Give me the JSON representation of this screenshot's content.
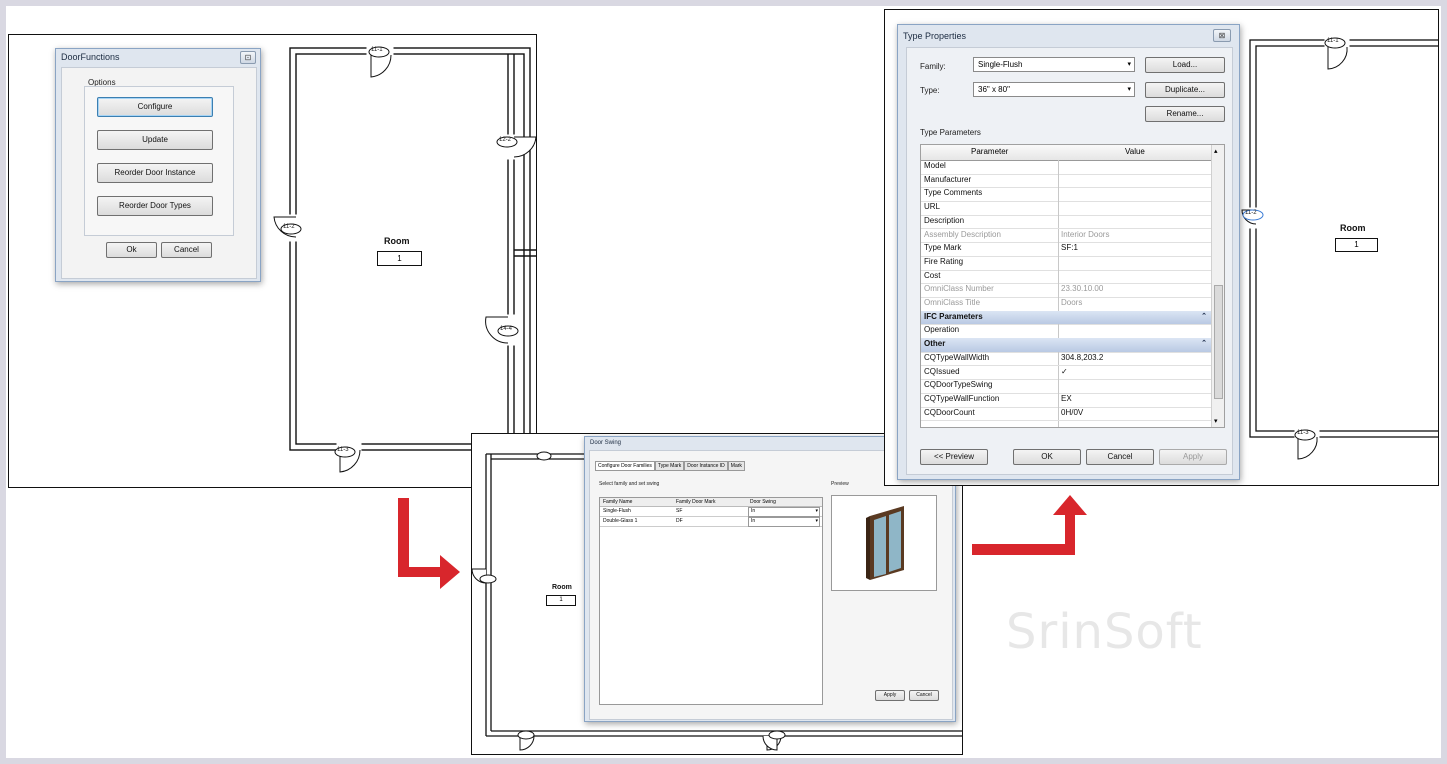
{
  "panel1": {
    "dialog_title": "DoorFunctions",
    "options_label": "Options",
    "buttons": [
      "Configure",
      "Update",
      "Reorder Door Instance",
      "Reorder Door Types"
    ],
    "ok_label": "Ok",
    "cancel_label": "Cancel",
    "room_label": "Room",
    "room_number": "1",
    "door_tags": [
      "11-1",
      "12-2",
      "11-2",
      "14-4",
      "11-3"
    ]
  },
  "panel2": {
    "dialog_title": "Door Swing",
    "tabs": [
      "Configure Door Families",
      "Type Mark",
      "Door Instance ID",
      "Mark"
    ],
    "instruction": "Select family and set swing",
    "preview_label": "Preview",
    "columns": [
      "Family Name",
      "Family Door Mark",
      "Door Swing"
    ],
    "rows": [
      {
        "family": "Single-Flush",
        "mark": "SF",
        "swing": "In"
      },
      {
        "family": "Double-Glass 1",
        "mark": "DF",
        "swing": "In"
      }
    ],
    "apply_label": "Apply",
    "cancel_label": "Cancel",
    "room_label": "Room",
    "room_number": "1"
  },
  "panel3": {
    "dialog_title": "Type Properties",
    "family_label": "Family:",
    "family_value": "Single-Flush",
    "type_label": "Type:",
    "type_value": "36\" x 80\"",
    "load_label": "Load...",
    "duplicate_label": "Duplicate...",
    "rename_label": "Rename...",
    "type_params_label": "Type Parameters",
    "col_parameter": "Parameter",
    "col_value": "Value",
    "params": [
      {
        "name": "Model",
        "value": ""
      },
      {
        "name": "Manufacturer",
        "value": ""
      },
      {
        "name": "Type Comments",
        "value": ""
      },
      {
        "name": "URL",
        "value": ""
      },
      {
        "name": "Description",
        "value": ""
      },
      {
        "name": "Assembly Description",
        "value": "Interior Doors",
        "grey": true
      },
      {
        "name": "Type Mark",
        "value": "SF:1"
      },
      {
        "name": "Fire Rating",
        "value": ""
      },
      {
        "name": "Cost",
        "value": ""
      },
      {
        "name": "OmniClass Number",
        "value": "23.30.10.00",
        "grey": true
      },
      {
        "name": "OmniClass Title",
        "value": "Doors",
        "grey": true
      },
      {
        "group": "IFC Parameters"
      },
      {
        "name": "Operation",
        "value": ""
      },
      {
        "group": "Other"
      },
      {
        "name": "CQTypeWallWidth",
        "value": "304.8,203.2"
      },
      {
        "name": "CQIssued",
        "value": "✓"
      },
      {
        "name": "CQDoorTypeSwing",
        "value": ""
      },
      {
        "name": "CQTypeWallFunction",
        "value": "EX"
      },
      {
        "name": "CQDoorCount",
        "value": "0H/0V"
      }
    ],
    "preview_btn": "<< Preview",
    "ok_label": "OK",
    "cancel_label": "Cancel",
    "apply_label": "Apply",
    "room_label": "Room",
    "room_number": "1",
    "door_tags": [
      "11-1",
      "11-2",
      "11-3"
    ]
  },
  "watermark": "SrinSoft",
  "colors": {
    "arrow": "#d8262c",
    "dialog_bg": "#dfe6ef",
    "group_header": "#c3d1e8"
  }
}
